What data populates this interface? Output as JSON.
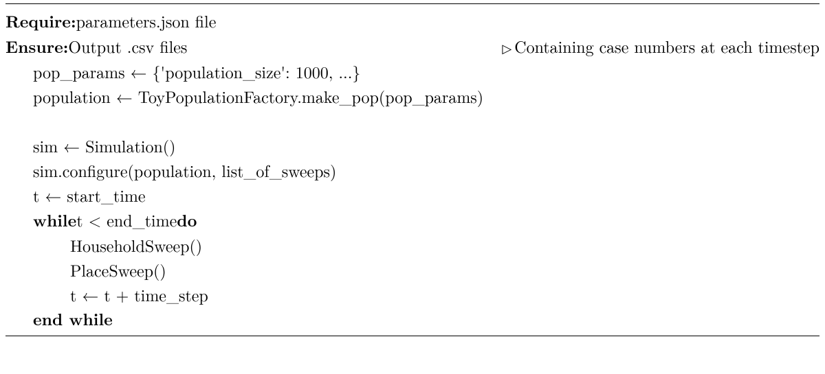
{
  "require_label": "Require:",
  "require_value": " parameters.json file",
  "ensure_label": "Ensure:",
  "ensure_value": " Output .csv files",
  "comment_text": "Containing case numbers at each timestep",
  "line_pop_params": "pop_params ← {'population_size': 1000, ...}",
  "line_population": "population ← ToyPopulationFactory.make_pop(pop_params)",
  "line_sim": "sim ← Simulation()",
  "line_configure": "sim.configure(population, list_of_sweeps)",
  "line_t_start": "t ← start_time",
  "while_label": "while",
  "while_cond": " t < end_time ",
  "do_label": "do",
  "line_household": "HouseholdSweep()",
  "line_place": "PlaceSweep()",
  "line_t_step": "t ← t + time_step",
  "end_while": "end while"
}
